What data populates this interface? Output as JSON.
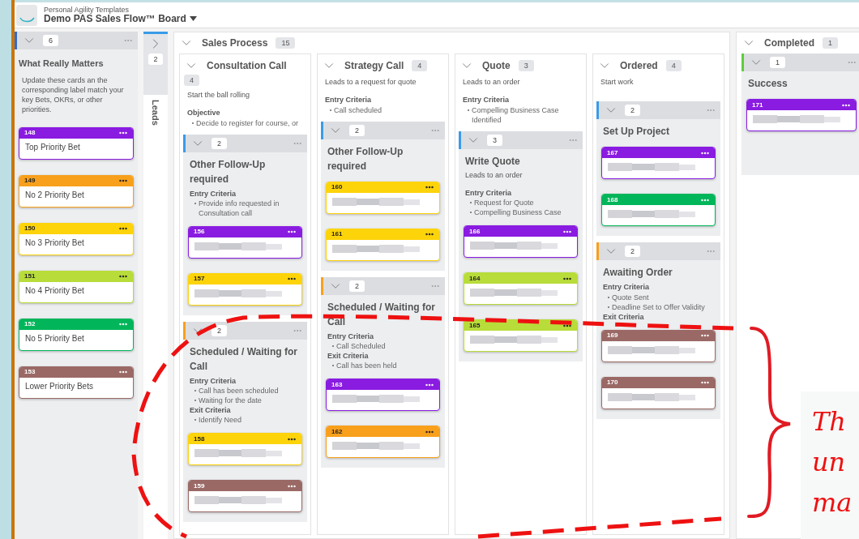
{
  "board": {
    "subtitle": "Personal Agility Templates",
    "title": "Demo PAS Sales Flow™ Board"
  },
  "priority_lane": {
    "count": "6",
    "color": "#2f6bd6",
    "title": "What Really Matters",
    "description": "Update these cards an the corresponding label match your key Bets, OKRs, or other priorities.",
    "cards": [
      {
        "number": "148",
        "color": "#8a1be0",
        "kind": "text",
        "text": "Top Priority Bet"
      },
      {
        "number": "149",
        "color": "#f8a01c",
        "kind": "text",
        "text": "No 2 Priority Bet"
      },
      {
        "number": "150",
        "color": "#fdd30a",
        "kind": "text",
        "text": "No 3 Priority Bet"
      },
      {
        "number": "151",
        "color": "#b8dc3a",
        "kind": "text",
        "text": "No 4 Priority Bet"
      },
      {
        "number": "152",
        "color": "#00b55a",
        "kind": "text",
        "text": "No 5 Priority Bet"
      },
      {
        "number": "153",
        "color": "#9a6966",
        "kind": "text",
        "text": "Lower Priority Bets"
      }
    ]
  },
  "collapsed_lane": {
    "count": "2",
    "title": "Leads"
  },
  "groups": [
    {
      "title": "Sales Process",
      "count": "15",
      "columns": [
        {
          "title": "Consultation Call",
          "count": "4",
          "blocks": [
            {
              "kind": "text",
              "text": "Start the ball rolling"
            },
            {
              "kind": "heading",
              "text": "Objective"
            },
            {
              "kind": "bullet",
              "text": "Decide to register for course, or"
            }
          ],
          "sublanes": [
            {
              "color": "#3a9be8",
              "count": "2",
              "title": "Other Follow-Up required",
              "blocks": [
                {
                  "kind": "heading",
                  "text": "Entry Criteria"
                },
                {
                  "kind": "bullet",
                  "text": "Provide info requested in Consultation call"
                }
              ],
              "cards": [
                {
                  "number": "156",
                  "color": "#8a1be0",
                  "kind": "redacted"
                },
                {
                  "number": "157",
                  "color": "#fdd30a",
                  "kind": "redacted"
                }
              ]
            },
            {
              "color": "#f8a01c",
              "count": "2",
              "title": "Scheduled / Waiting for Call",
              "blocks": [
                {
                  "kind": "heading",
                  "text": "Entry Criteria"
                },
                {
                  "kind": "bullet",
                  "text": "Call has been scheduled"
                },
                {
                  "kind": "bullet",
                  "text": "Waiting for the date"
                },
                {
                  "kind": "heading",
                  "text": "Exit Criteria"
                },
                {
                  "kind": "bullet",
                  "text": "Identify Need"
                }
              ],
              "cards": [
                {
                  "number": "158",
                  "color": "#fdd30a",
                  "kind": "redacted"
                },
                {
                  "number": "159",
                  "color": "#9a6966",
                  "kind": "redacted"
                }
              ]
            }
          ]
        },
        {
          "title": "Strategy Call",
          "count": "4",
          "blocks": [
            {
              "kind": "text",
              "text": "Leads to a request for quote"
            },
            {
              "kind": "heading",
              "text": "Entry Criteria"
            },
            {
              "kind": "bullet",
              "text": "Call scheduled"
            }
          ],
          "sublanes": [
            {
              "color": "#3a9be8",
              "count": "2",
              "title": "Other Follow-Up required",
              "cards": [
                {
                  "number": "160",
                  "color": "#fdd30a",
                  "kind": "redacted"
                },
                {
                  "number": "161",
                  "color": "#fdd30a",
                  "kind": "redacted"
                }
              ]
            },
            {
              "color": "#f8a01c",
              "count": "2",
              "title": "Scheduled / Waiting for Call",
              "blocks": [
                {
                  "kind": "heading",
                  "text": "Entry Criteria"
                },
                {
                  "kind": "bullet",
                  "text": "Call Scheduled"
                },
                {
                  "kind": "heading",
                  "text": "Exit Criteria"
                },
                {
                  "kind": "bullet",
                  "text": "Call has been held"
                }
              ],
              "cards": [
                {
                  "number": "163",
                  "color": "#8a1be0",
                  "kind": "redacted"
                },
                {
                  "number": "162",
                  "color": "#f8a01c",
                  "kind": "redacted"
                }
              ]
            }
          ]
        },
        {
          "title": "Quote",
          "count": "3",
          "blocks": [
            {
              "kind": "text",
              "text": "Leads to an order"
            },
            {
              "kind": "heading",
              "text": "Entry Criteria"
            },
            {
              "kind": "bullet",
              "text": "Compelling Business Case Identified"
            }
          ],
          "sublanes": [
            {
              "color": "#3a9be8",
              "count": "3",
              "title": "Write Quote",
              "blocks": [
                {
                  "kind": "text",
                  "text": "Leads to an order"
                },
                {
                  "kind": "heading",
                  "text": "Entry Criteria"
                },
                {
                  "kind": "bullet",
                  "text": "Request for Quote"
                },
                {
                  "kind": "bullet",
                  "text": "Compelling Business Case"
                }
              ],
              "cards": [
                {
                  "number": "166",
                  "color": "#8a1be0",
                  "kind": "redacted"
                },
                {
                  "number": "164",
                  "color": "#b8dc3a",
                  "kind": "redacted"
                },
                {
                  "number": "165",
                  "color": "#b8dc3a",
                  "kind": "redacted"
                }
              ]
            }
          ]
        },
        {
          "title": "Ordered",
          "count": "4",
          "blocks": [
            {
              "kind": "text",
              "text": "Start work"
            }
          ],
          "sublanes": [
            {
              "color": "#3a9be8",
              "count": "2",
              "title": "Set Up Project",
              "cards": [
                {
                  "number": "167",
                  "color": "#8a1be0",
                  "kind": "redacted"
                },
                {
                  "number": "168",
                  "color": "#00b55a",
                  "kind": "redacted"
                }
              ]
            },
            {
              "color": "#f8a01c",
              "count": "2",
              "title": "Awaiting Order",
              "blocks": [
                {
                  "kind": "heading",
                  "text": "Entry Criteria"
                },
                {
                  "kind": "bullet",
                  "text": "Quote Sent"
                },
                {
                  "kind": "bullet",
                  "text": "Deadline Set to Offer Validity"
                },
                {
                  "kind": "heading",
                  "text": "Exit Criteria"
                }
              ],
              "cards": [
                {
                  "number": "169",
                  "color": "#9a6966",
                  "kind": "redacted"
                },
                {
                  "number": "170",
                  "color": "#9a6966",
                  "kind": "redacted"
                }
              ]
            }
          ]
        }
      ]
    },
    {
      "title": "Completed",
      "count": "1",
      "sublanes": [
        {
          "color": "#5ccd3c",
          "count": "1",
          "title": "Success",
          "cards": [
            {
              "number": "171",
              "color": "#8a1be0",
              "kind": "redacted"
            }
          ]
        }
      ]
    }
  ],
  "note": {
    "lines": [
      "Th",
      "un",
      "ma"
    ]
  }
}
